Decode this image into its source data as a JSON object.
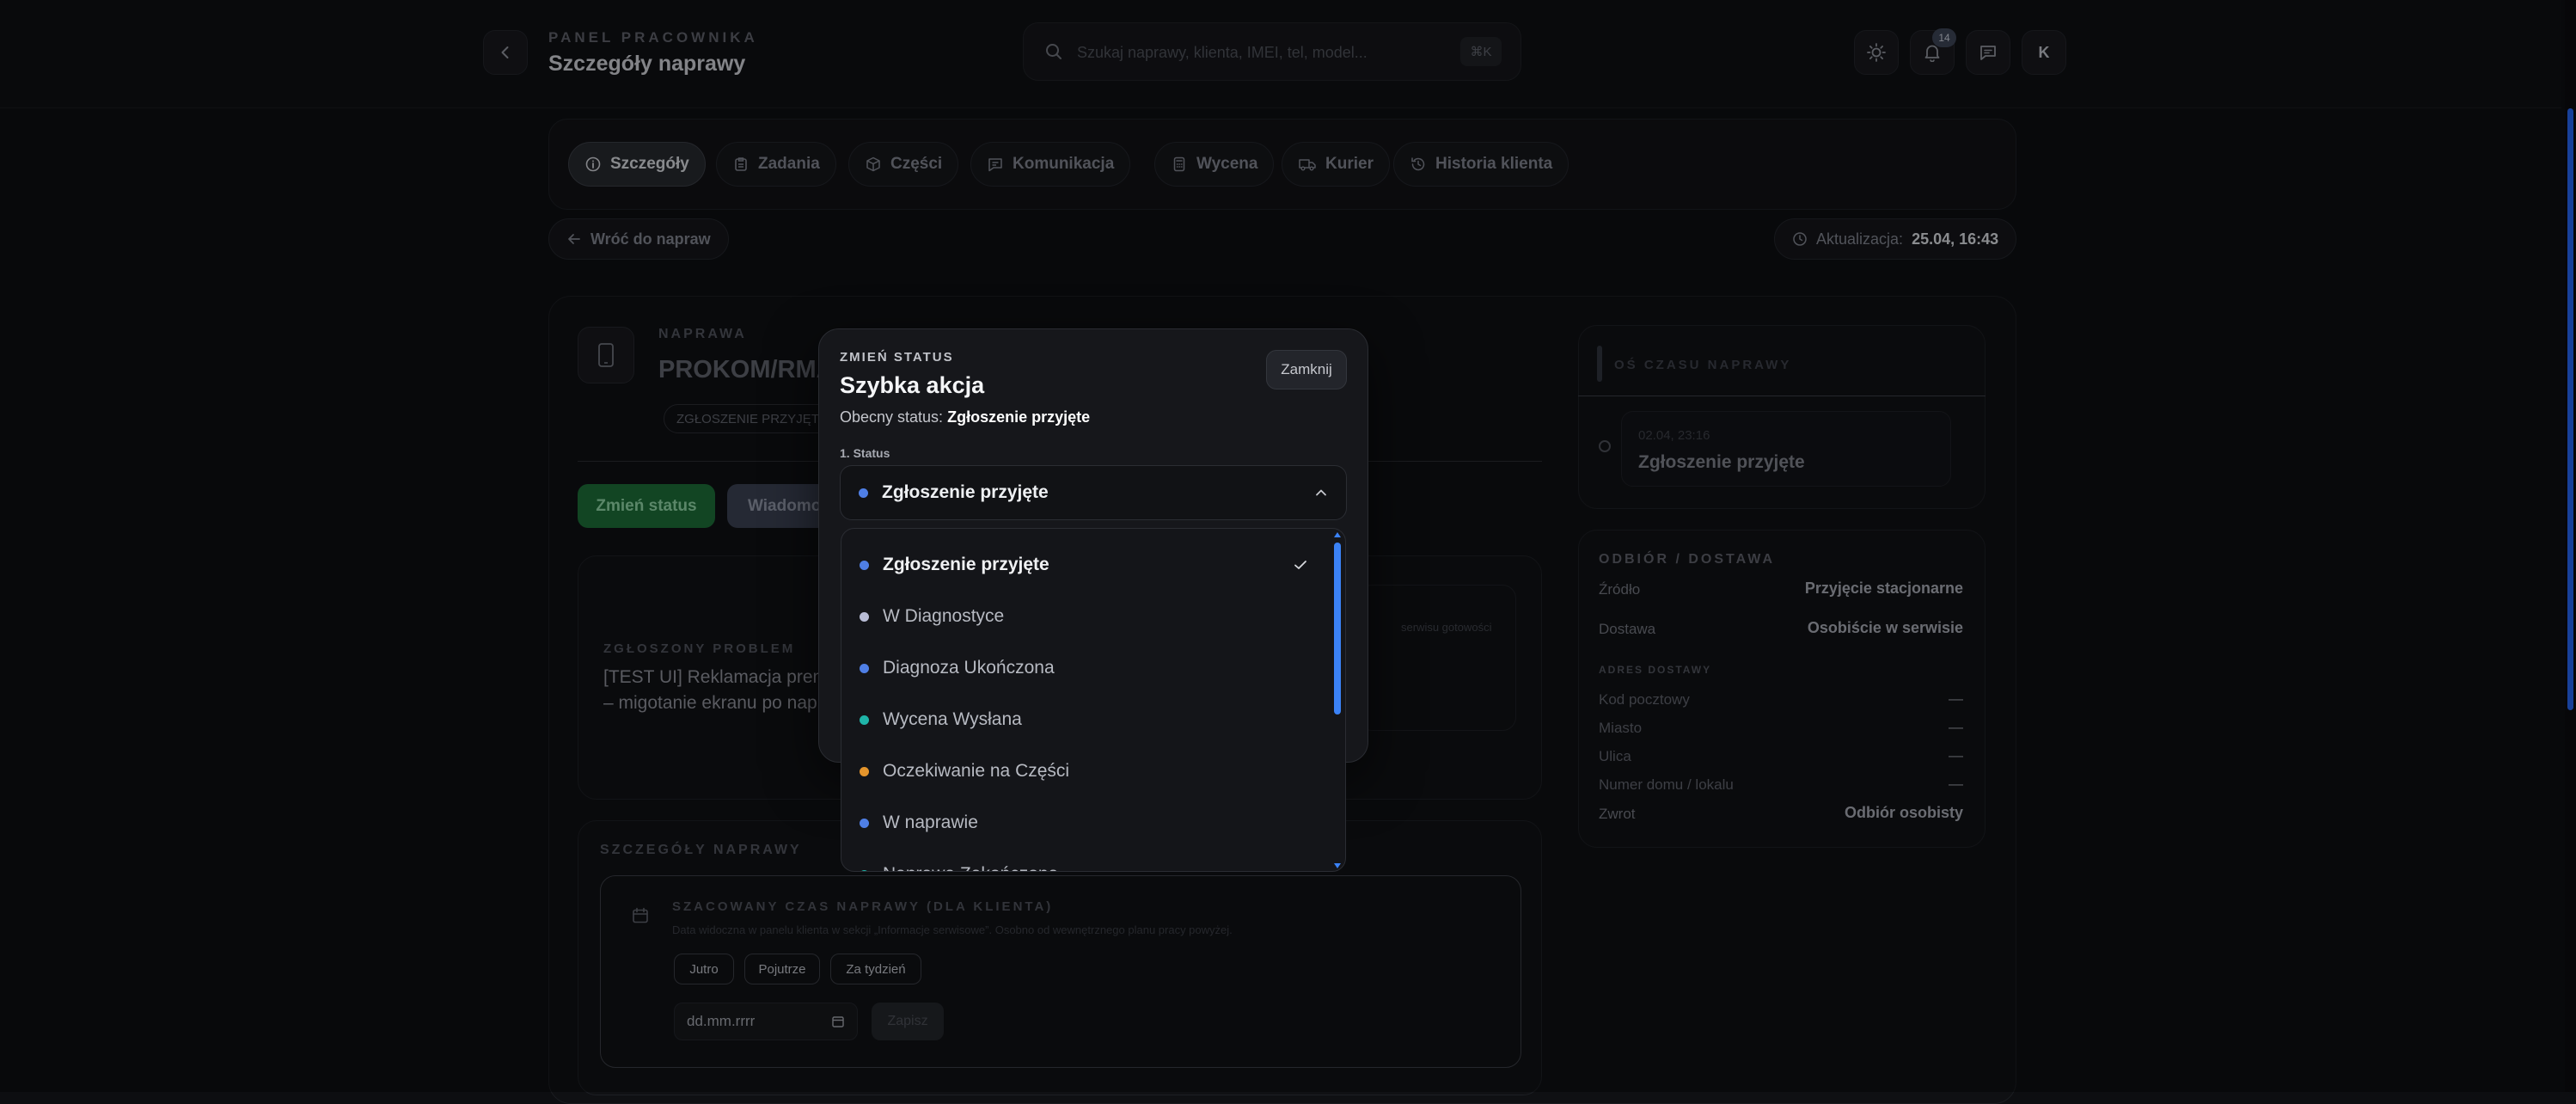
{
  "header": {
    "eyebrow": "PANEL PRACOWNIKA",
    "title": "Szczegóły naprawy",
    "search_placeholder": "Szukaj naprawy, klienta, IMEI, tel, model...",
    "search_shortcut": "⌘K",
    "notifications_count": "14",
    "avatar_initial": "K"
  },
  "tabs": [
    {
      "label": "Szczegóły",
      "icon": "info-icon",
      "active": true
    },
    {
      "label": "Zadania",
      "icon": "clipboard-icon"
    },
    {
      "label": "Części",
      "icon": "box-icon"
    },
    {
      "label": "Komunikacja",
      "icon": "message-icon"
    },
    {
      "label": "Wycena",
      "icon": "calculator-icon"
    },
    {
      "label": "Kurier",
      "icon": "truck-icon"
    },
    {
      "label": "Historia klienta",
      "icon": "history-icon"
    }
  ],
  "back_link": "Wróć do napraw",
  "update": {
    "label": "Aktualizacja:",
    "value": "25.04, 16:43"
  },
  "repair": {
    "eyebrow": "NAPRAWA",
    "number": "PROKOM/RMA",
    "status_chip": "ZGŁOSZENIE PRZYJĘTE",
    "change_status_button": "Zmień status",
    "message_button": "Wiadomo",
    "problem_label": "ZGŁOSZONY PROBLEM",
    "problem_text_line1": "[TEST UI] Reklamacja prem",
    "problem_text_line2": "– migotanie ekranu po nap",
    "side_note": "serwisu gotowości"
  },
  "details": {
    "section_label": "SZCZEGÓŁY NAPRAWY",
    "estimate_title": "SZACOWANY CZAS NAPRAWY (DLA KLIENTA)",
    "estimate_hint": "Data widoczna w panelu klienta w sekcji „Informacje serwisowe”. Osobno od wewnętrznego planu pracy powyżej.",
    "quick_dates": [
      "Jutro",
      "Pojutrze",
      "Za tydzień"
    ],
    "date_placeholder": "dd.mm.rrrr",
    "save_button": "Zapisz"
  },
  "timeline": {
    "title": "OŚ CZASU NAPRAWY",
    "entry_time": "02.04, 23:16",
    "entry_title": "Zgłoszenie przyjęte"
  },
  "delivery": {
    "title": "ODBIÓR / DOSTAWA",
    "rows": [
      {
        "label": "Źródło",
        "value": "Przyjęcie stacjonarne"
      },
      {
        "label": "Dostawa",
        "value": "Osobiście w serwisie"
      }
    ],
    "address_title": "ADRES DOSTAWY",
    "address_rows": [
      {
        "label": "Kod pocztowy",
        "value": "—"
      },
      {
        "label": "Miasto",
        "value": "—"
      },
      {
        "label": "Ulica",
        "value": "—"
      },
      {
        "label": "Numer domu / lokalu",
        "value": "—"
      }
    ],
    "return_label": "Zwrot",
    "return_value": "Odbiór osobisty"
  },
  "modal": {
    "eyebrow": "ZMIEŃ STATUS",
    "title": "Szybka akcja",
    "current_label": "Obecny status:",
    "current_value": "Zgłoszenie przyjęte",
    "close_button": "Zamknij",
    "field_label": "1. Status",
    "selected": "Zgłoszenie przyjęte",
    "options": [
      {
        "label": "Zgłoszenie przyjęte",
        "color": "#4f7fe6",
        "selected": true
      },
      {
        "label": "W Diagnostyce",
        "color": "#b9bdd6"
      },
      {
        "label": "Diagnoza Ukończona",
        "color": "#4f7fe6"
      },
      {
        "label": "Wycena Wysłana",
        "color": "#1fb5a9"
      },
      {
        "label": "Oczekiwanie na Części",
        "color": "#e5952c"
      },
      {
        "label": "W naprawie",
        "color": "#4f7fe6"
      },
      {
        "label": "Naprawa Zakończona",
        "color": "#1fb5a9"
      }
    ]
  },
  "colors": {
    "accent": "#3b82f6",
    "success": "#22a04b"
  }
}
